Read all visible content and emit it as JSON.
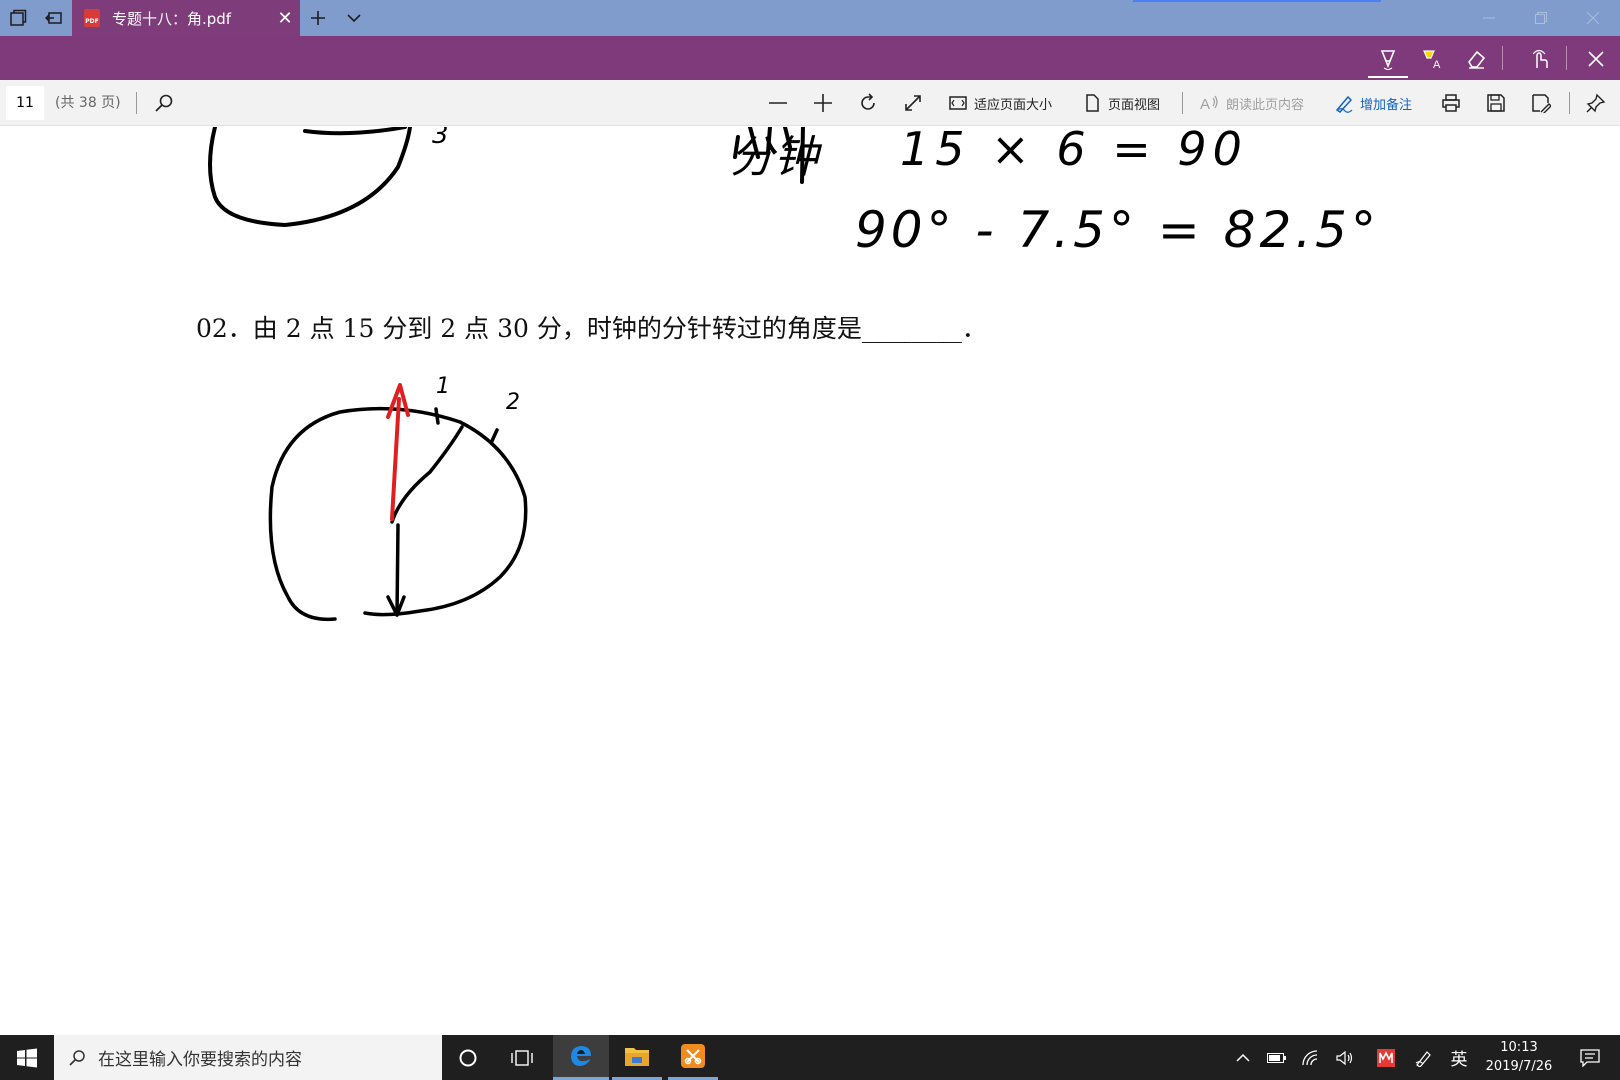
{
  "tab": {
    "title": "专题十八：角.pdf",
    "icon_label": "PDF"
  },
  "toolbar": {
    "page_number": "11",
    "page_total": "(共 38 页)",
    "fit_page_label": "适应页面大小",
    "page_view_label": "页面视图",
    "read_aloud_label": "朗读此页内容",
    "add_notes_label": "增加备注"
  },
  "document": {
    "question": "02．由 2 点 15 分到 2 点 30 分，时钟的分针转过的角度是________．",
    "handwriting": {
      "line1_label": "分钟",
      "line1_expr": "15 × 6  = 90",
      "line2_expr": "90° - 7.5° = 82.5°",
      "clock_top_number": "3",
      "tick_label_1": "1",
      "tick_label_2": "2"
    },
    "ink_colors": {
      "black": "#000000",
      "red": "#e02020"
    }
  },
  "taskbar": {
    "search_placeholder": "在这里输入你要搜索的内容",
    "ime_label": "英",
    "time": "10:13",
    "date": "2019/7/26"
  },
  "colors": {
    "title_bar": "#7f9ccc",
    "ink_bar": "#7e3a7b",
    "accent_blue": "#1565c0"
  }
}
